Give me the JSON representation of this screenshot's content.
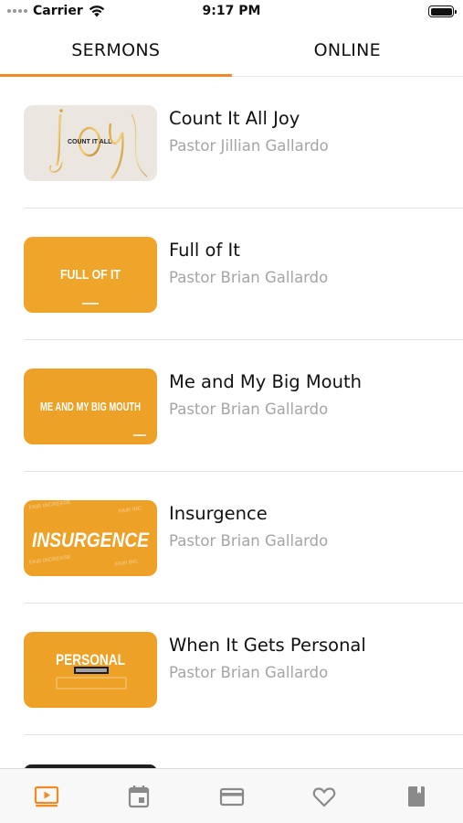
{
  "status_bar": {
    "carrier": "Carrier",
    "time": "9:17 PM",
    "icons": [
      "signal-dots-icon",
      "wifi-icon",
      "battery-icon"
    ]
  },
  "tabs": [
    {
      "label": "SERMONS",
      "active": true
    },
    {
      "label": "ONLINE",
      "active": false
    }
  ],
  "sermons": [
    {
      "title": "Count It All Joy",
      "speaker": "Pastor Jillian Gallardo",
      "thumb_text": "COUNT IT ALL",
      "thumb_script": "joy"
    },
    {
      "title": "Full of It",
      "speaker": "Pastor Brian Gallardo",
      "thumb_text": "FULL OF IT"
    },
    {
      "title": "Me and My Big Mouth",
      "speaker": "Pastor Brian Gallardo",
      "thumb_text": "ME AND MY BIG MOUTH"
    },
    {
      "title": "Insurgence",
      "speaker": "Pastor Brian Gallardo",
      "thumb_text": "INSURGENCE"
    },
    {
      "title": "When It Gets Personal",
      "speaker": "Pastor Brian Gallardo",
      "thumb_text": "PERSONAL"
    }
  ],
  "bottom_nav": [
    {
      "icon": "play-video-icon",
      "active": true
    },
    {
      "icon": "calendar-icon",
      "active": false
    },
    {
      "icon": "credit-card-icon",
      "active": false
    },
    {
      "icon": "heart-icon",
      "active": false
    },
    {
      "icon": "book-icon",
      "active": false
    }
  ],
  "colors": {
    "accent": "#f08a24",
    "thumb_orange": "#eda126",
    "inactive_icon": "#8a8a8a",
    "subtitle": "#a5a5a5"
  }
}
